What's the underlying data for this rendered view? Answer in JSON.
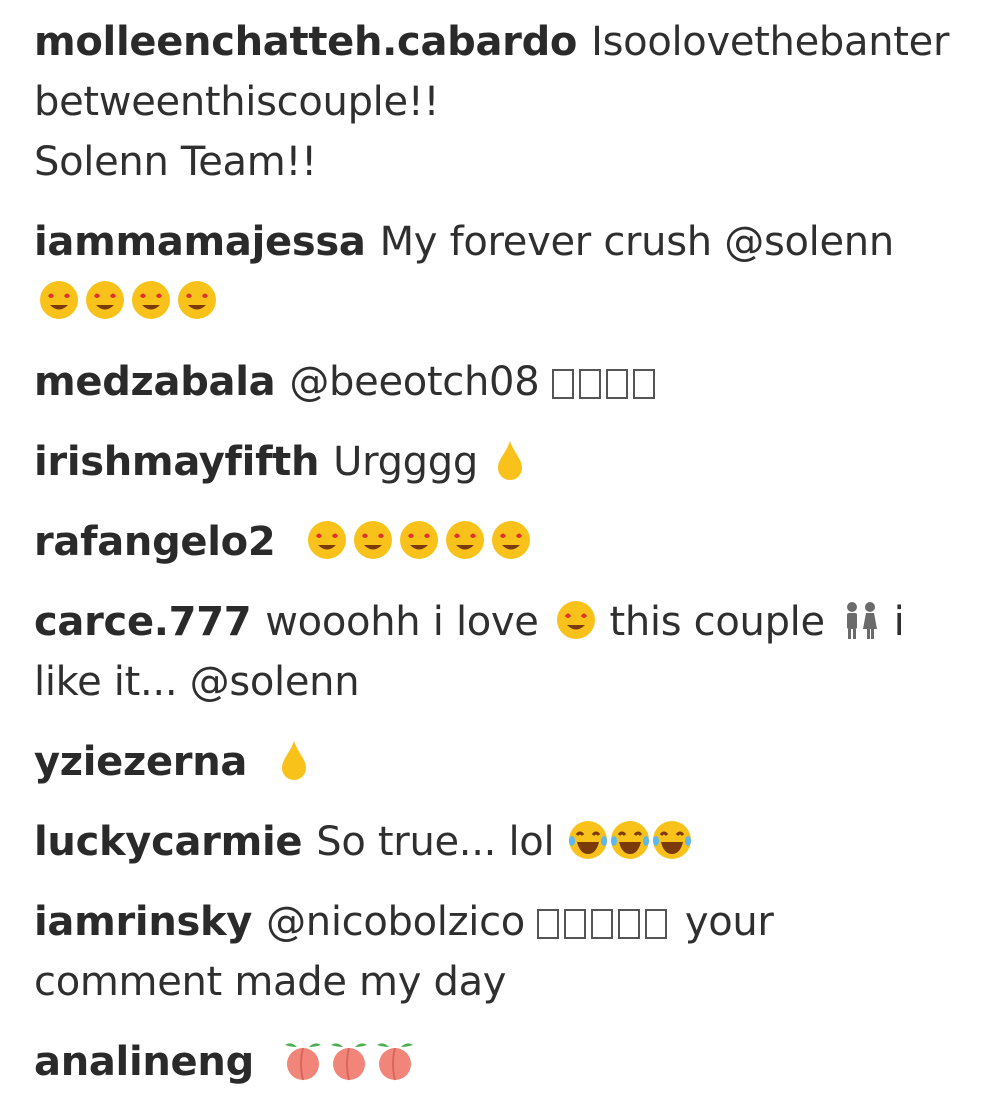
{
  "comments": [
    {
      "username": "molleenchatteh.cabardo",
      "text_a": "Isoolovethebanter",
      "text_b": "betweenthiscouple!!",
      "text_c": "Solenn Team!!"
    },
    {
      "username": "iammamajessa",
      "text_a": "My forever crush @solenn",
      "emojis": [
        "heart-eyes-emoji",
        "heart-eyes-emoji",
        "heart-eyes-emoji",
        "heart-eyes-emoji"
      ]
    },
    {
      "username": "medzabala",
      "text_a": "@beeotch08"
    },
    {
      "username": "irishmayfifth",
      "text_a": "Urgggg",
      "emojis": [
        "drop-emoji"
      ]
    },
    {
      "username": "rafangelo2",
      "emojis": [
        "heart-eyes-emoji",
        "heart-eyes-emoji",
        "heart-eyes-emoji",
        "heart-eyes-emoji",
        "heart-eyes-emoji"
      ]
    },
    {
      "username": "carce.777",
      "text_a": "wooohh i love",
      "text_b": "this couple",
      "text_c": "i",
      "text_d": "like it... @solenn",
      "emojis": [
        "heart-eyes-emoji",
        "couple-emoji"
      ]
    },
    {
      "username": "yziezerna",
      "emojis": [
        "drop-emoji"
      ]
    },
    {
      "username": "luckycarmie",
      "text_a": "So true... lol",
      "emojis": [
        "laugh-emoji",
        "laugh-emoji",
        "laugh-emoji"
      ]
    },
    {
      "username": "iamrinsky",
      "text_a": "@nicobolzico",
      "text_b": "your",
      "text_c": "comment made my day"
    },
    {
      "username": "analineng",
      "emojis": [
        "peach-emoji",
        "peach-emoji",
        "peach-emoji"
      ]
    }
  ],
  "colors": {
    "text": "#262626",
    "emoji_yellow": "#f8c21a",
    "emoji_orange": "#f59b1b",
    "heart_red": "#e0312f",
    "peach": "#f2857a"
  }
}
